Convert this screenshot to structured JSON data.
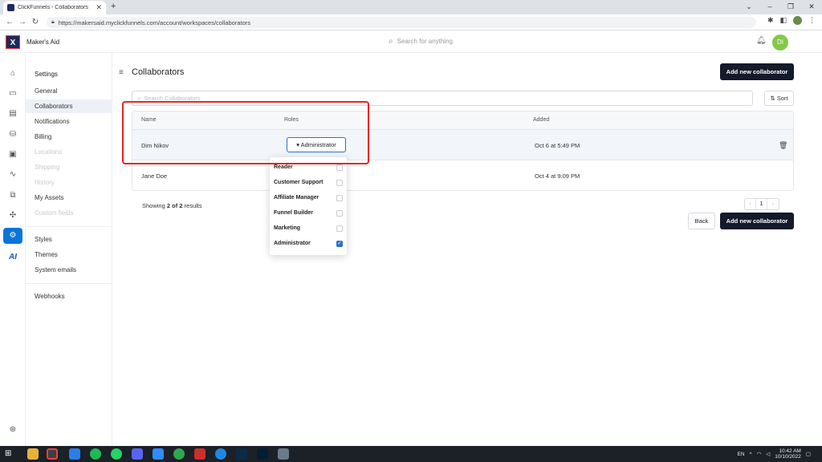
{
  "browser": {
    "tab_title": "ClickFunnels - Collaborators",
    "tab_close": "✕",
    "new_tab": "+",
    "url": "https://makersaid.myclickfunnels.com/account/workspaces/collaborators",
    "window_controls": [
      "⌄",
      "–",
      "❐",
      "✕"
    ]
  },
  "app": {
    "logo_letter": "X",
    "workspace_name": "Maker's Aid",
    "search_placeholder": "Search for anything",
    "avatar_initials": "DI"
  },
  "rail": {
    "ai_label": "AI"
  },
  "sidebar": {
    "heading": "Settings",
    "items": [
      {
        "label": "General",
        "state": "normal"
      },
      {
        "label": "Collaborators",
        "state": "active"
      },
      {
        "label": "Notifications",
        "state": "normal"
      },
      {
        "label": "Billing",
        "state": "normal"
      },
      {
        "label": "Locations",
        "state": "disabled"
      },
      {
        "label": "Shipping",
        "state": "disabled"
      },
      {
        "label": "History",
        "state": "disabled"
      },
      {
        "label": "My Assets",
        "state": "normal"
      },
      {
        "label": "Custom fields",
        "state": "disabled"
      }
    ],
    "items2": [
      {
        "label": "Styles"
      },
      {
        "label": "Themes"
      },
      {
        "label": "System emails"
      }
    ],
    "items3": [
      {
        "label": "Webhooks"
      }
    ]
  },
  "main": {
    "title": "Collaborators",
    "add_button": "Add new collaborator",
    "search_placeholder": "Search Collaborators",
    "sort_button": "Sort",
    "columns": {
      "name": "Name",
      "roles": "Roles",
      "added": "Added"
    },
    "rows": [
      {
        "name": "Dim Nikov",
        "role": "Administrator",
        "added": "Oct 6 at 5:49 PM"
      },
      {
        "name": "Jane Doe",
        "added": "Oct 4 at 9:09 PM"
      }
    ],
    "results_prefix": "Showing ",
    "results_bold": "2 of 2",
    "results_suffix": " results",
    "pager": {
      "prev": "‹",
      "page": "1",
      "next": "›"
    },
    "back_button": "Back",
    "add_button_bottom": "Add new collaborator"
  },
  "roles_dropdown": [
    {
      "label": "Reader",
      "checked": false
    },
    {
      "label": "Customer Support",
      "checked": false
    },
    {
      "label": "Affiliate Manager",
      "checked": false
    },
    {
      "label": "Funnel Builder",
      "checked": false
    },
    {
      "label": "Marketing",
      "checked": false
    },
    {
      "label": "Administrator",
      "checked": true
    }
  ],
  "taskbar": {
    "lang": "EN",
    "time": "10:42 AM",
    "date": "10/10/2022"
  },
  "colors": {
    "primary_dark": "#14192b",
    "accent_blue": "#2a6fcf",
    "annotation_red": "#e22",
    "avatar_green": "#84c84a"
  }
}
